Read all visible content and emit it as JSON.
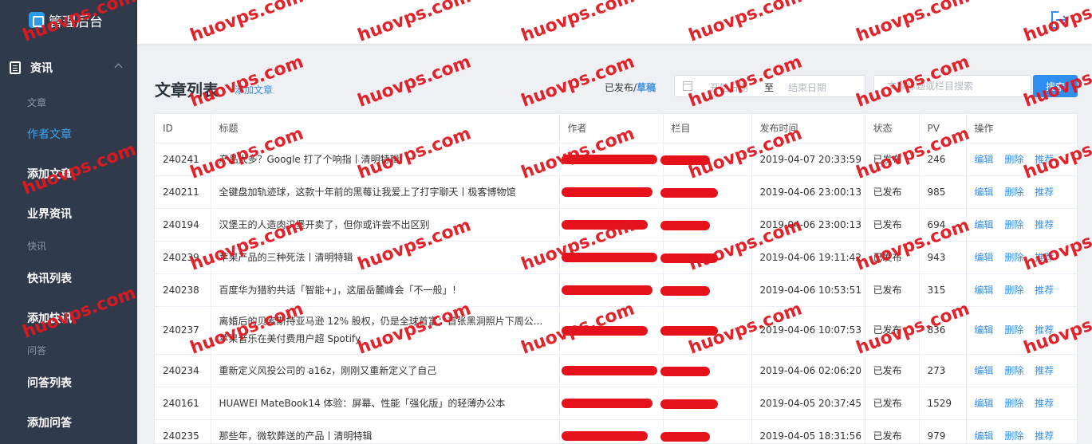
{
  "sidebar": {
    "brand": "管理后台",
    "group_title": "资讯",
    "sub_news": "文章",
    "items_news": [
      {
        "label": "作者文章"
      },
      {
        "label": "添加文章"
      },
      {
        "label": "业界资讯"
      }
    ],
    "sub_flash": "快讯",
    "items_flash": [
      {
        "label": "快讯列表"
      },
      {
        "label": "添加快讯"
      }
    ],
    "sub_qa": "问答",
    "items_qa": [
      {
        "label": "问答列表"
      },
      {
        "label": "添加问答"
      }
    ]
  },
  "header": {
    "logout_icon": "logout-icon"
  },
  "main": {
    "title": "文章列表",
    "add_link": "添加文章",
    "filter_published": "已发布",
    "filter_sep": "/",
    "filter_draft": "草稿",
    "date_start_placeholder": "开始日期",
    "date_sep": "至",
    "date_end_placeholder": "结束日期",
    "search_placeholder": "文章标题或栏目搜索",
    "search_button": "搜索"
  },
  "table": {
    "headers": [
      "ID",
      "标题",
      "作者",
      "栏目",
      "发布时间",
      "状态",
      "PV",
      "操作"
    ],
    "actions": [
      "编辑",
      "删除",
      "推荐"
    ],
    "rows": [
      {
        "id": "240241",
        "title": "产品太多？Google 打了个响指丨清明特辑",
        "time": "2019-04-07 20:33:59",
        "status": "已发布",
        "pv": "246"
      },
      {
        "id": "240211",
        "title": "全键盘加轨迹球，这款十年前的黑莓让我爱上了打字聊天丨极客博物馆",
        "time": "2019-04-06 23:00:13",
        "status": "已发布",
        "pv": "985"
      },
      {
        "id": "240194",
        "title": "汉堡王的人造肉汉堡开卖了，但你或许尝不出区别",
        "time": "2019-04-06 23:00:13",
        "status": "已发布",
        "pv": "694"
      },
      {
        "id": "240239",
        "title": "苹果产品的三种死法丨清明特辑",
        "time": "2019-04-06 19:11:42",
        "status": "已发布",
        "pv": "943"
      },
      {
        "id": "240238",
        "title": "百度华为猎豹共话「智能+」，这届岳麓峰会「不一般」！",
        "time": "2019-04-06 10:53:51",
        "status": "已发布",
        "pv": "315"
      },
      {
        "id": "240237",
        "title": "离婚后的贝索斯持亚马逊 12% 股权，仍是全球首富；首张黑洞照片下周公...",
        "title2": "苹果音乐在美付费用户超 Spotify",
        "time": "2019-04-06 10:07:53",
        "status": "已发布",
        "pv": "836"
      },
      {
        "id": "240234",
        "title": "重新定义风投公司的 a16z，刚刚又重新定义了自己",
        "time": "2019-04-06 02:06:20",
        "status": "已发布",
        "pv": "273"
      },
      {
        "id": "240161",
        "title": "HUAWEI MateBook14 体验：屏幕、性能「强化版」的轻薄办公本",
        "time": "2019-04-05 20:37:45",
        "status": "已发布",
        "pv": "1529"
      },
      {
        "id": "240235",
        "title": "那些年，微软葬送的产品丨清明特辑",
        "time": "2019-04-05 18:31:56",
        "status": "已发布",
        "pv": "979"
      }
    ]
  },
  "watermark": "huovps.com",
  "colors": {
    "sidebar_bg": "#2f3a4b",
    "accent": "#2f8ef1",
    "watermark": "#e01820"
  }
}
